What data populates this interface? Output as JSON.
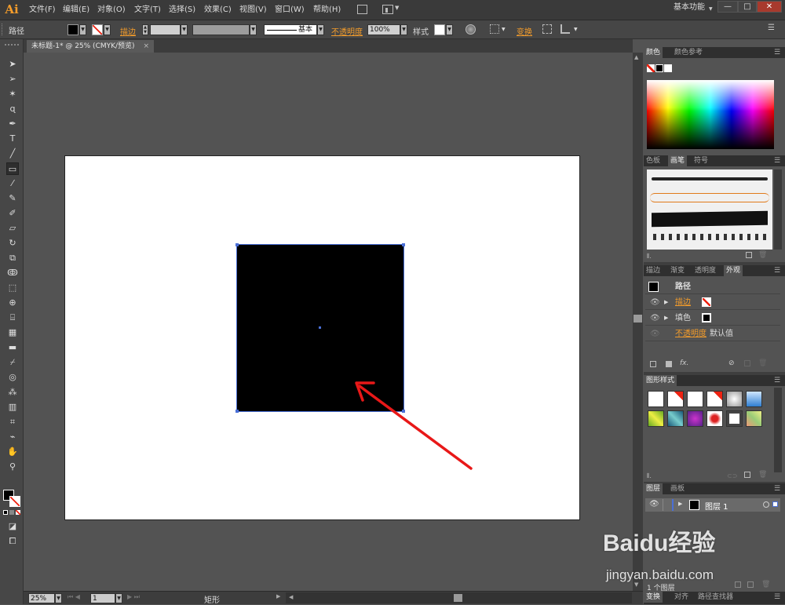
{
  "app": {
    "logo": "Ai",
    "workspace": "基本功能"
  },
  "menu": [
    "文件(F)",
    "编辑(E)",
    "对象(O)",
    "文字(T)",
    "选择(S)",
    "效果(C)",
    "视图(V)",
    "窗口(W)",
    "帮助(H)"
  ],
  "control": {
    "object_type": "路径",
    "stroke_label": "描边",
    "stroke_style": "基本",
    "opacity_label": "不透明度",
    "opacity_value": "100%",
    "style_label": "样式",
    "transform_label": "变换"
  },
  "document": {
    "tab_title": "未标题-1* @ 25% (CMYK/预览)"
  },
  "status": {
    "zoom": "25%",
    "page": "1",
    "tool_name": "矩形"
  },
  "panels": {
    "color_tabs": [
      "颜色",
      "颜色参考"
    ],
    "brush_tabs": [
      "色板",
      "画笔",
      "符号"
    ],
    "appearance_tabs": [
      "描边",
      "渐变",
      "透明度",
      "外观"
    ],
    "appearance": {
      "title": "路径",
      "stroke_label": "描边",
      "fill_label": "填色",
      "opacity_label": "不透明度",
      "opacity_value": "默认值"
    },
    "graphic_styles_tab": "图形样式",
    "layers_tabs": [
      "图层",
      "画板"
    ],
    "layer_name": "图层 1",
    "layers_count": "1 个图层",
    "bottom_tabs": [
      "变换",
      "对齐",
      "路径查找器"
    ]
  },
  "colors": {
    "accent": "#f39c2b",
    "selection": "#4a6fd6",
    "arrow": "#e81818"
  },
  "watermark": {
    "brand": "Baidu经验",
    "url": "jingyan.baidu.com"
  }
}
